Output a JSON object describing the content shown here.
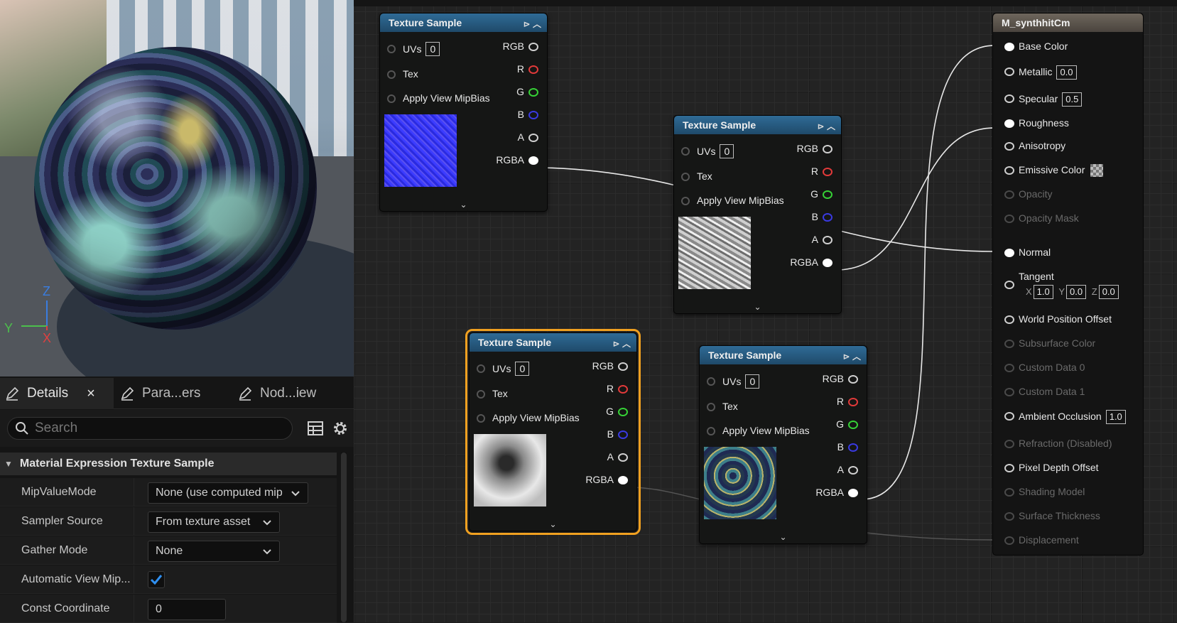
{
  "viewport": {
    "axis": {
      "z": "Z",
      "y": "Y",
      "x": "X"
    }
  },
  "tabs": [
    {
      "label": "Details",
      "active": true,
      "close": "×"
    },
    {
      "label": "Para...ers",
      "active": false
    },
    {
      "label": "Nod...iew",
      "active": false
    }
  ],
  "details": {
    "search_placeholder": "Search",
    "section_title": "Material Expression Texture Sample",
    "properties": [
      {
        "label": "MipValueMode",
        "value": "None (use computed mip"
      },
      {
        "label": "Sampler Source",
        "value": "From texture asset"
      },
      {
        "label": "Gather Mode",
        "value": "None"
      },
      {
        "label": "Automatic View Mip...",
        "value": true
      },
      {
        "label": "Const Coordinate",
        "value": "0"
      }
    ]
  },
  "texture_node": {
    "title": "Texture Sample",
    "inputs": {
      "uvs": "UVs",
      "uvs_value": "0",
      "tex": "Tex",
      "mip": "Apply View MipBias"
    },
    "outputs": {
      "rgb": "RGB",
      "r": "R",
      "g": "G",
      "b": "B",
      "a": "A",
      "rgba": "RGBA"
    },
    "expand": "⌄"
  },
  "material_node": {
    "title": "M_synthhitCm",
    "pins": [
      {
        "label": "Base Color",
        "active": true,
        "connected": true
      },
      {
        "label": "Metallic",
        "active": true,
        "value": "0.0"
      },
      {
        "label": "Specular",
        "active": true,
        "value": "0.5"
      },
      {
        "label": "Roughness",
        "active": true,
        "connected": true
      },
      {
        "label": "Anisotropy",
        "active": true
      },
      {
        "label": "Emissive Color",
        "active": true,
        "swatch": true
      },
      {
        "label": "Opacity",
        "active": false
      },
      {
        "label": "Opacity Mask",
        "active": false
      },
      {
        "label": "Normal",
        "active": true,
        "connected": true
      },
      {
        "label": "Tangent",
        "active": true,
        "xyz": {
          "x": "1.0",
          "y": "0.0",
          "z": "0.0",
          "xl": "X",
          "yl": "Y",
          "zl": "Z"
        }
      },
      {
        "label": "World Position Offset",
        "active": true
      },
      {
        "label": "Subsurface Color",
        "active": false
      },
      {
        "label": "Custom Data 0",
        "active": false
      },
      {
        "label": "Custom Data 1",
        "active": false
      },
      {
        "label": "Ambient Occlusion",
        "active": true,
        "value": "1.0"
      },
      {
        "label": "Refraction (Disabled)",
        "active": false
      },
      {
        "label": "Pixel Depth Offset",
        "active": true
      },
      {
        "label": "Shading Model",
        "active": false
      },
      {
        "label": "Surface Thickness",
        "active": false
      },
      {
        "label": "Displacement",
        "active": false
      }
    ]
  }
}
